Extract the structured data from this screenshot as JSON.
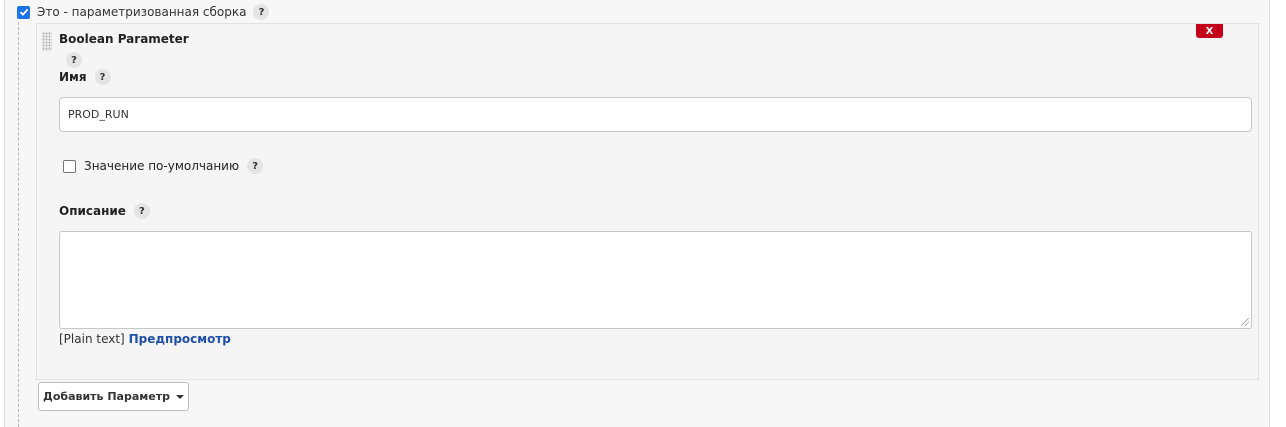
{
  "parameterized": {
    "label": "Это - параметризованная сборка",
    "checked": true,
    "help": "?"
  },
  "parameter": {
    "title": "Boolean Parameter",
    "title_help": "?",
    "remove_label": "X",
    "name": {
      "label": "Имя",
      "help": "?",
      "value": "PROD_RUN"
    },
    "default": {
      "label": "Значение по-умолчанию",
      "help": "?",
      "checked": false
    },
    "description": {
      "label": "Описание",
      "help": "?",
      "value": ""
    },
    "format": {
      "plain_text": "[Plain text]",
      "preview_link": "Предпросмотр"
    }
  },
  "add_parameter": {
    "label": "Добавить Параметр"
  },
  "icons": {
    "check": "check-icon",
    "caret": "caret-down-icon",
    "drag": "drag-handle-icon"
  },
  "colors": {
    "checkbox": "#1a73e8",
    "remove": "#c4001a",
    "link": "#1f4fa8"
  }
}
